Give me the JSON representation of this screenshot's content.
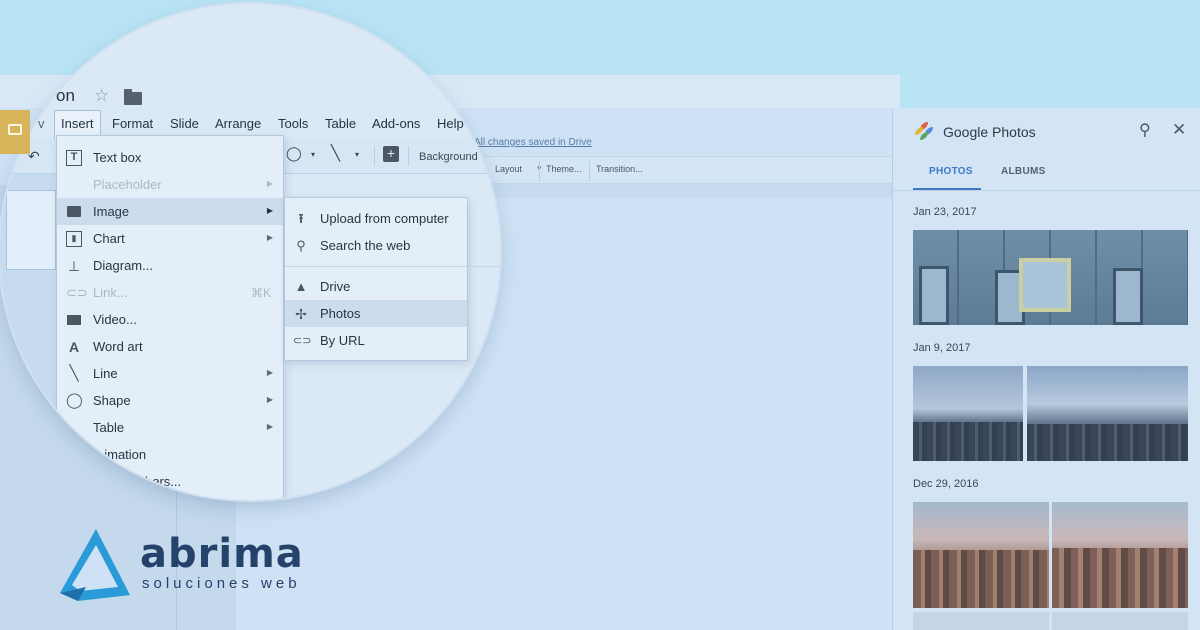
{
  "app": {
    "title_partial": "on",
    "saved_status": "All changes saved in Drive",
    "toolbar_items": [
      "Layout",
      "Theme...",
      "Transition..."
    ],
    "lens_toolbar": {
      "background": "Background"
    }
  },
  "menubar": [
    "Insert",
    "Format",
    "Slide",
    "Arrange",
    "Tools",
    "Table",
    "Add-ons",
    "Help"
  ],
  "insert_menu": {
    "items": [
      {
        "label": "Text box",
        "icon": "text-box-icon"
      },
      {
        "label": "Placeholder",
        "disabled": true,
        "submenu": true
      },
      {
        "label": "Image",
        "icon": "image-icon",
        "submenu": true,
        "highlighted": true
      },
      {
        "label": "Chart",
        "icon": "chart-icon",
        "submenu": true
      },
      {
        "label": "Diagram...",
        "icon": "diagram-icon"
      },
      {
        "label": "Link...",
        "icon": "link-icon",
        "disabled": true,
        "shortcut": "⌘K"
      },
      {
        "label": "Video...",
        "icon": "video-icon"
      },
      {
        "label": "Word art",
        "icon": "word-art-icon"
      },
      {
        "label": "Line",
        "icon": "line-icon",
        "submenu": true
      },
      {
        "label": "Shape",
        "icon": "shape-icon",
        "submenu": true
      },
      {
        "label": "Table",
        "submenu": true
      },
      {
        "label": "nimation"
      },
      {
        "label": "bers..."
      }
    ]
  },
  "image_submenu": {
    "items": [
      {
        "label": "Upload from computer",
        "icon": "upload-icon"
      },
      {
        "label": "Search the web",
        "icon": "search-icon"
      },
      {
        "label": "Drive",
        "icon": "drive-icon"
      },
      {
        "label": "Photos",
        "icon": "photos-icon",
        "highlighted": true
      },
      {
        "label": "By URL",
        "icon": "link-icon"
      }
    ]
  },
  "google_photos": {
    "title": "Google Photos",
    "tabs": [
      {
        "label": "PHOTOS",
        "active": true
      },
      {
        "label": "ALBUMS",
        "active": false
      }
    ],
    "groups": [
      {
        "date": "Jan 23, 2017"
      },
      {
        "date": "Jan 9, 2017"
      },
      {
        "date": "Dec 29, 2016"
      }
    ],
    "accent_color": "#3f78c4"
  },
  "brand": {
    "name": "abrima",
    "tagline": "soluciones web",
    "color": "#25426a",
    "accent": "#2b9ad8"
  }
}
